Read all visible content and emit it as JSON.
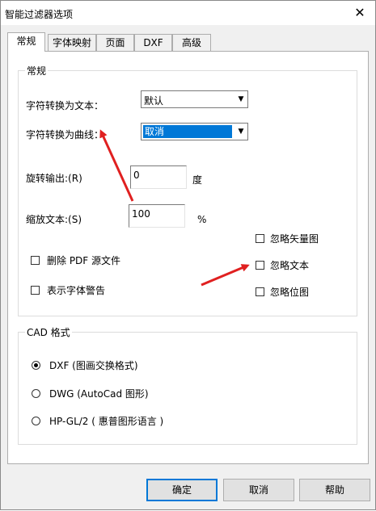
{
  "window": {
    "title": "智能过滤器选项",
    "close_glyph": "✕"
  },
  "tabs": [
    {
      "label": "常规"
    },
    {
      "label": "字体映射"
    },
    {
      "label": "页面"
    },
    {
      "label": "DXF"
    },
    {
      "label": "高级"
    }
  ],
  "general": {
    "group_label": "常规",
    "text_to_text_label": "字符转换为文本：",
    "text_to_text_value": "默认",
    "text_to_curve_label": "字符转换为曲线：",
    "text_to_curve_value": "取消",
    "rotate_label": "旋转输出:(R)",
    "rotate_value": "0",
    "rotate_unit": "度",
    "scale_label": "缩放文本:(S)",
    "scale_value": "100",
    "scale_unit": "%",
    "ignore_vector_label": "忽略矢量图",
    "ignore_text_label": "忽略文本",
    "ignore_bitmap_label": "忽略位图",
    "delete_pdf_label": "删除 PDF 源文件",
    "font_warning_label": "表示字体警告"
  },
  "cad": {
    "group_label": "CAD 格式",
    "options": [
      {
        "label": "DXF (图画交换格式)",
        "selected": true
      },
      {
        "label": "DWG (AutoCad 图形)",
        "selected": false
      },
      {
        "label": "HP-GL/2 ( 惠普图形语言 )",
        "selected": false
      }
    ]
  },
  "buttons": {
    "ok": "确定",
    "cancel": "取消",
    "help": "帮助"
  },
  "colors": {
    "annotation_arrow": "#e02020",
    "selection": "#0078d7"
  }
}
